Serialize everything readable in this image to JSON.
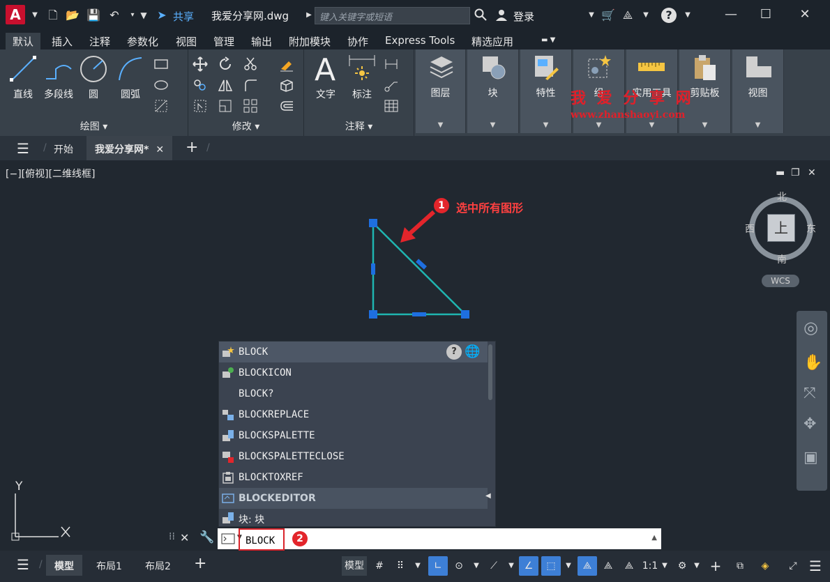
{
  "titlebar": {
    "logo": "A",
    "share_label": "共享",
    "doc_title": "我爱分享网.dwg",
    "search_placeholder": "键入关键字或短语",
    "login_label": "登录",
    "help_label": "?"
  },
  "ribbon_tabs": [
    "默认",
    "插入",
    "注释",
    "参数化",
    "视图",
    "管理",
    "输出",
    "附加模块",
    "协作",
    "Express Tools",
    "精选应用"
  ],
  "ribbon": {
    "draw": {
      "title": "绘图",
      "tools": [
        "直线",
        "多段线",
        "圆",
        "圆弧"
      ]
    },
    "modify": {
      "title": "修改"
    },
    "annotation": {
      "title": "注释",
      "tools": [
        "文字",
        "标注"
      ]
    },
    "panels": [
      "图层",
      "块",
      "特性",
      "组",
      "实用工具",
      "剪贴板",
      "视图"
    ]
  },
  "watermark": {
    "title": "我 爱 分 享 网",
    "url": "www.zhanshaoyi.com"
  },
  "file_tabs": {
    "start": "开始",
    "doc": "我爱分享网*"
  },
  "viewport": {
    "label": "[−][俯视][二维线框]",
    "viewcube": {
      "north": "北",
      "south": "南",
      "east": "东",
      "west": "西",
      "face": "上",
      "wcs": "WCS"
    },
    "ucs_y": "Y"
  },
  "annotations": {
    "step1_num": "1",
    "step1_text": "选中所有图形",
    "step2_num": "2"
  },
  "autocomplete": {
    "items": [
      "BLOCK",
      "BLOCKICON",
      "BLOCK?",
      "BLOCKREPLACE",
      "BLOCKSPALETTE",
      "BLOCKSPALETTECLOSE",
      "BLOCKTOXREF",
      "BLOCKEDITOR",
      "块: 块"
    ]
  },
  "command": {
    "value": "BLOCK"
  },
  "statusbar": {
    "tabs": [
      "模型",
      "布局1",
      "布局2"
    ],
    "model_button": "模型",
    "scale": "1:1"
  },
  "colors": {
    "accent": "#3d7fd6",
    "highlight_red": "#d9232a",
    "triangle": "#1fb5b0",
    "grip": "#1e6fe0"
  }
}
